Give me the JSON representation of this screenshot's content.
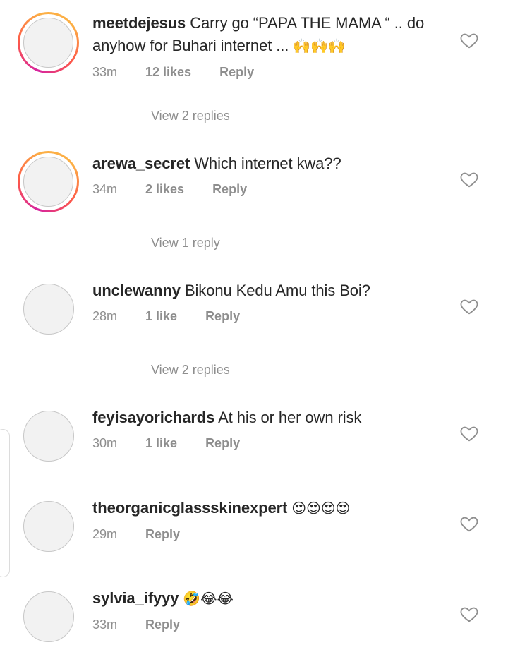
{
  "comments": [
    {
      "username": "meetdejesus",
      "text": "Carry go “PAPA THE MAMA “ .. do anyhow for Buhari internet ...",
      "emoji": "🙌🙌🙌",
      "time": "33m",
      "likes": "12 likes",
      "reply": "Reply",
      "story_ring": true,
      "view_replies": "View 2 replies"
    },
    {
      "username": "arewa_secret",
      "text": "Which internet kwa??",
      "emoji": "",
      "time": "34m",
      "likes": "2 likes",
      "reply": "Reply",
      "story_ring": true,
      "view_replies": "View 1 reply"
    },
    {
      "username": "unclewanny",
      "text": "Bikonu Kedu Amu this Boi?",
      "emoji": "",
      "time": "28m",
      "likes": "1 like",
      "reply": "Reply",
      "story_ring": false,
      "view_replies": "View 2 replies"
    },
    {
      "username": "feyisayorichards",
      "text": "At his or her own risk",
      "emoji": "",
      "time": "30m",
      "likes": "1 like",
      "reply": "Reply",
      "story_ring": false,
      "view_replies": ""
    },
    {
      "username": "theorganicglassskinexpert",
      "text": "",
      "emoji": "😍😍😍😍",
      "time": "29m",
      "likes": "",
      "reply": "Reply",
      "story_ring": false,
      "view_replies": ""
    },
    {
      "username": "sylvia_ifyyy",
      "text": "",
      "emoji": "🤣😂😂",
      "time": "33m",
      "likes": "",
      "reply": "Reply",
      "story_ring": false,
      "view_replies": ""
    }
  ],
  "icons": {
    "like": "heart-outline-icon"
  },
  "colors": {
    "text": "#262626",
    "muted": "#8e8e8e",
    "divider": "#c7c7c7"
  }
}
